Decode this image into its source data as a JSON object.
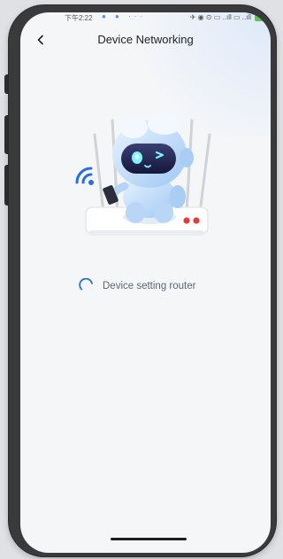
{
  "status_bar": {
    "time": "下午2:22",
    "dots": "● ● ···",
    "right_icons": "✈ ◉ ⊙ ▭ ..ıll ▭ ..ıll"
  },
  "header": {
    "back_icon": "chevron-left-icon",
    "title": "Device Networking"
  },
  "illustration": {
    "robot_icon": "robot-icon",
    "router_icon": "router-icon",
    "wifi_icon": "wifi-signal-icon"
  },
  "progress": {
    "label": "Device setting router",
    "icon": "loading-spinner-icon"
  },
  "colors": {
    "accent": "#2a6de1",
    "screen_bg": "#f5f6f8",
    "router_led": "#e43b3b"
  }
}
